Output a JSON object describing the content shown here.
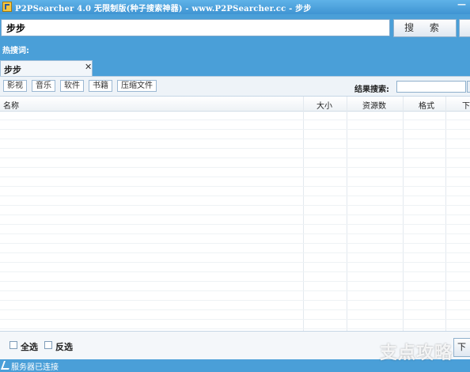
{
  "window": {
    "title": "P2PSearcher 4.0 无限制版(种子搜索神器) - www.P2PSearcher.cc - 步步",
    "min_glyph": "—"
  },
  "search": {
    "query": "步步",
    "button_label": "搜 索"
  },
  "hotwords": {
    "label": "热搜词:"
  },
  "tabs": [
    {
      "label": "步步",
      "close_glyph": "✕"
    }
  ],
  "filters": [
    {
      "label": "影视"
    },
    {
      "label": "音乐"
    },
    {
      "label": "软件"
    },
    {
      "label": "书籍"
    },
    {
      "label": "压缩文件"
    }
  ],
  "result_search": {
    "label": "结果搜索:",
    "value": ""
  },
  "table": {
    "columns": [
      "名称",
      "大小",
      "资源数",
      "格式",
      "下"
    ],
    "rows": []
  },
  "bottom": {
    "select_all": "全选",
    "invert_selection": "反选",
    "download_button": "下"
  },
  "status": {
    "text": "服务器已连接"
  },
  "watermark": {
    "text": "支点攻略"
  },
  "colors": {
    "frame_blue": "#4a9fd8",
    "panel_bg": "#eef3f8",
    "button_border": "#8fb0cc"
  },
  "icons": [
    "app-icon",
    "minimize-icon",
    "close-tab-icon",
    "status-connected-icon"
  ]
}
